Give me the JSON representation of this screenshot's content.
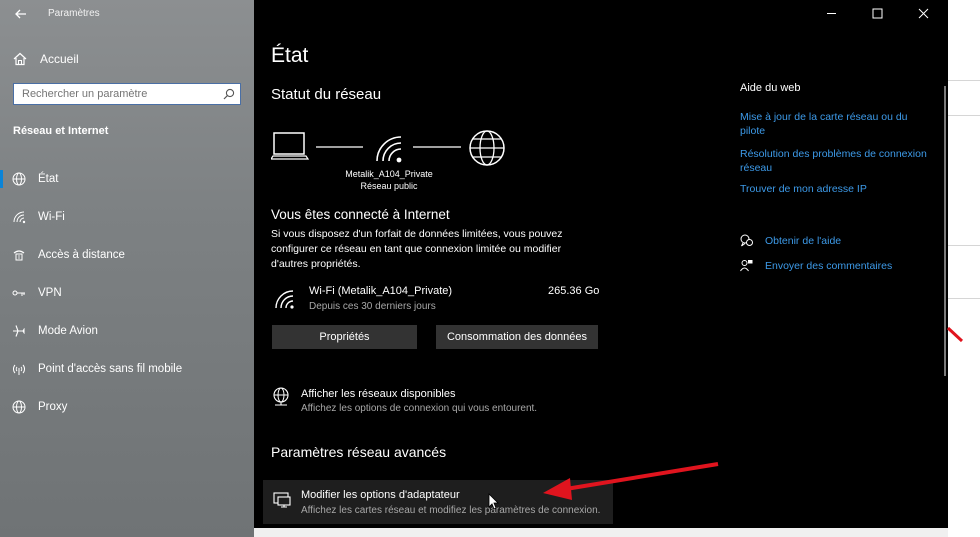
{
  "window": {
    "title": "Paramètres"
  },
  "sidebar": {
    "home_label": "Accueil",
    "search_placeholder": "Rechercher un paramètre",
    "section_title": "Réseau et Internet",
    "items": [
      {
        "label": "État",
        "icon": "globe-status-icon"
      },
      {
        "label": "Wi-Fi",
        "icon": "wifi-icon"
      },
      {
        "label": "Accès à distance",
        "icon": "dialup-icon"
      },
      {
        "label": "VPN",
        "icon": "vpn-icon"
      },
      {
        "label": "Mode Avion",
        "icon": "airplane-icon"
      },
      {
        "label": "Point d'accès sans fil mobile",
        "icon": "hotspot-icon"
      },
      {
        "label": "Proxy",
        "icon": "proxy-globe-icon"
      }
    ]
  },
  "main": {
    "title": "État",
    "network_status_heading": "Statut du réseau",
    "network_name": "Metalik_A104_Private",
    "network_type": "Réseau public",
    "connected_title": "Vous êtes connecté à Internet",
    "connected_desc": "Si vous disposez d'un forfait de données limitées, vous pouvez configurer ce réseau en tant que connexion limitée ou modifier d'autres propriétés.",
    "wifi": {
      "name": "Wi-Fi (Metalik_A104_Private)",
      "sub": "Depuis ces 30 derniers jours",
      "usage": "265.36 Go"
    },
    "buttons": {
      "properties": "Propriétés",
      "data_usage": "Consommation des données"
    },
    "available_networks": {
      "title": "Afficher les réseaux disponibles",
      "sub": "Affichez les options de connexion qui vous entourent."
    },
    "advanced_heading": "Paramètres réseau avancés",
    "adapter": {
      "title": "Modifier les options d'adaptateur",
      "sub": "Affichez les cartes réseau et modifiez les paramètres de connexion."
    }
  },
  "web_help": {
    "title": "Aide du web",
    "links": [
      "Mise à jour de la carte réseau ou du pilote",
      "Résolution des problèmes de connexion réseau",
      "Trouver de mon adresse IP"
    ],
    "get_help": "Obtenir de l'aide",
    "feedback": "Envoyer des commentaires"
  },
  "colors": {
    "accent": "#0a84d8",
    "link": "#3d9ae8",
    "annotation_arrow": "#e0141e"
  }
}
